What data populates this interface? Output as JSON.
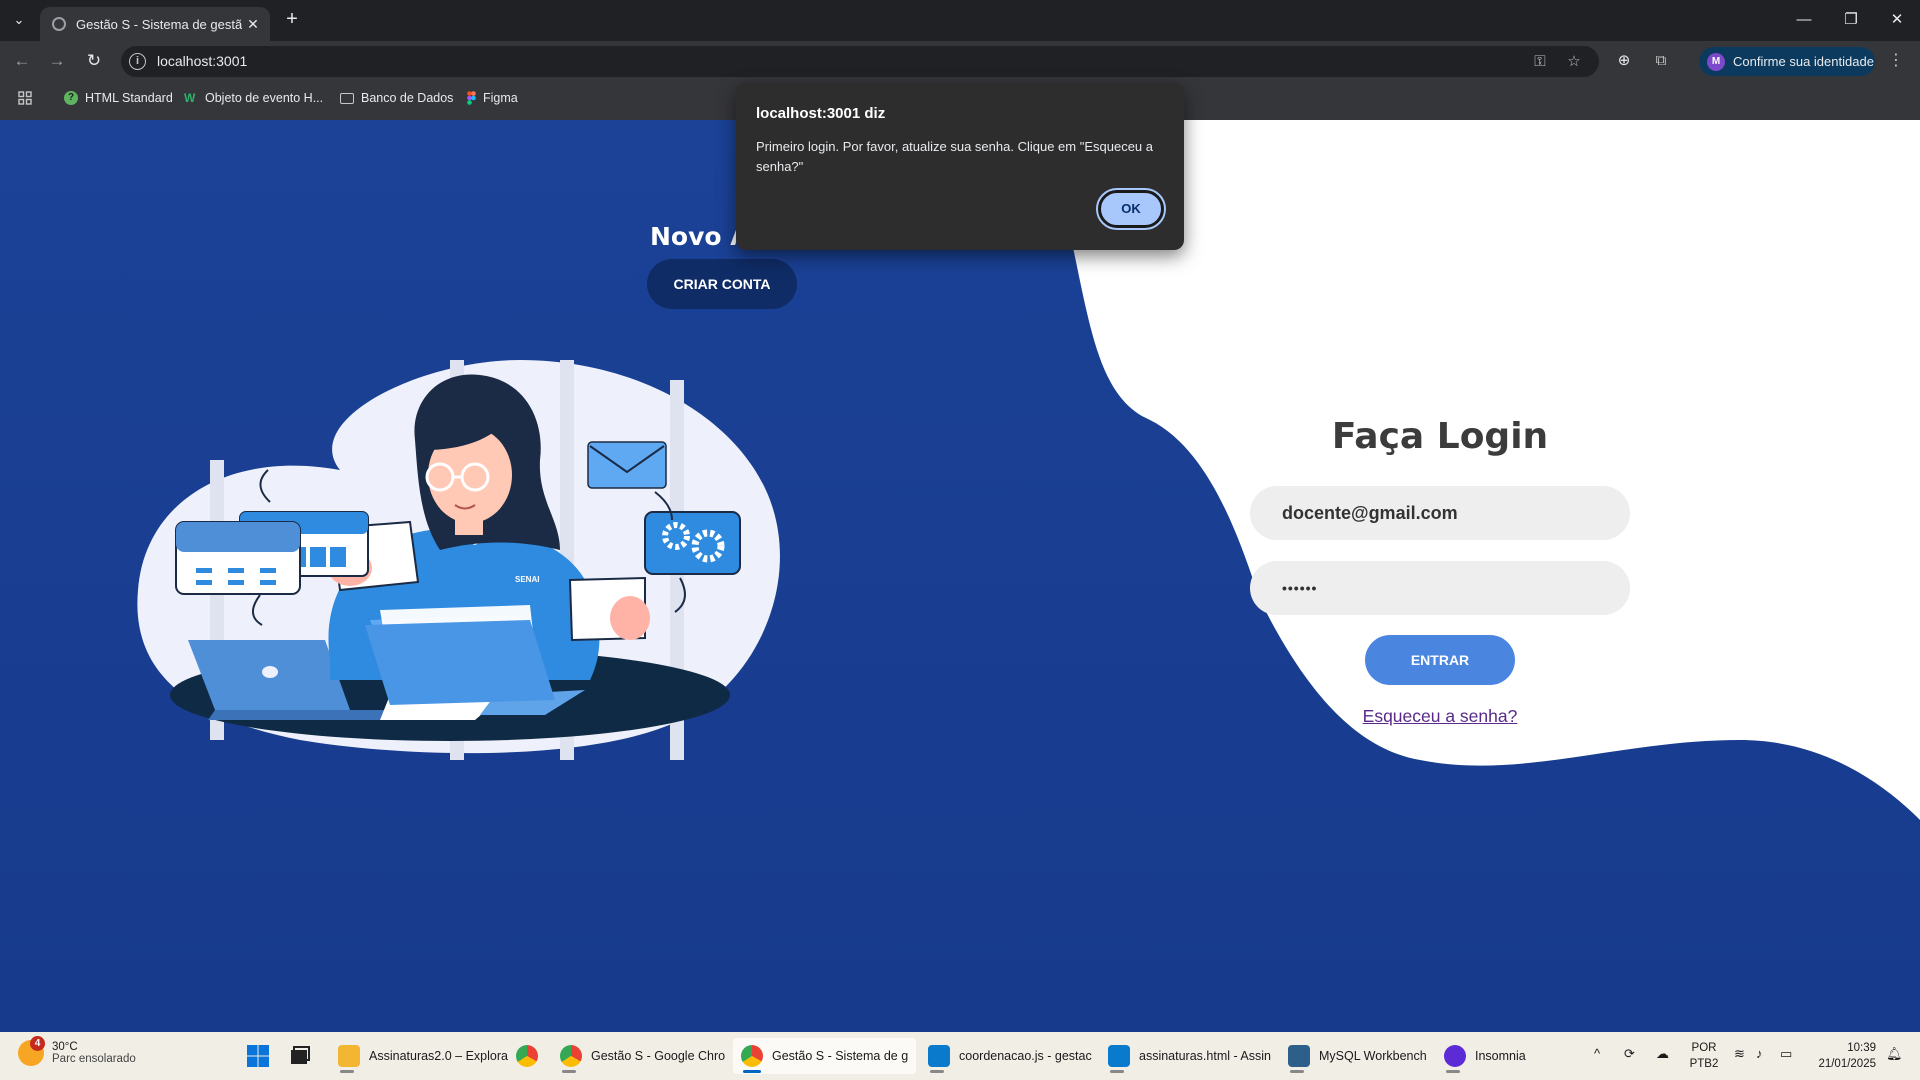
{
  "browser": {
    "tab_title": "Gestão S - Sistema de gestão",
    "url": "localhost:3001",
    "profile_label": "Confirme sua identidade",
    "profile_initial": "M",
    "bookmarks": [
      "HTML Standard",
      "Objeto de evento H...",
      "Banco de Dados",
      "Figma"
    ]
  },
  "page": {
    "new_account_title": "Novo A",
    "create_account_button": "CRIAR CONTA",
    "login_title": "Faça Login",
    "email_value": "docente@gmail.com",
    "password_value": "••••••",
    "login_button": "ENTRAR",
    "forgot_link": "Esqueceu a senha?",
    "illustration_badge": "SENAI"
  },
  "dialog": {
    "title": "localhost:3001 diz",
    "message": "Primeiro login. Por favor, atualize sua senha. Clique em \"Esqueceu a senha?\"",
    "ok_label": "OK"
  },
  "taskbar": {
    "weather_temp": "30°C",
    "weather_desc": "Parc ensolarado",
    "weather_badge": "4",
    "apps": [
      {
        "label": "Assinaturas2.0 – Explora",
        "color": "#f2b632"
      },
      {
        "label": "",
        "color": "#34a853"
      },
      {
        "label": "Gestão S - Google Chro",
        "color": "#34a853"
      },
      {
        "label": "Gestão S - Sistema de g",
        "color": "#34a853"
      },
      {
        "label": "coordenacao.js - gestac",
        "color": "#0a7acc"
      },
      {
        "label": "assinaturas.html - Assin",
        "color": "#0a7acc"
      },
      {
        "label": "MySQL Workbench",
        "color": "#2c5f8a"
      },
      {
        "label": "Insomnia",
        "color": "#5d2bd6"
      }
    ],
    "lang_line1": "POR",
    "lang_line2": "PTB2",
    "time": "10:39",
    "date": "21/01/2025"
  },
  "colors": {
    "page_blue": "#1b4297",
    "create_button": "#0f2c66",
    "login_button": "#4a86e0",
    "dialog_ok": "#a8c7fa"
  }
}
